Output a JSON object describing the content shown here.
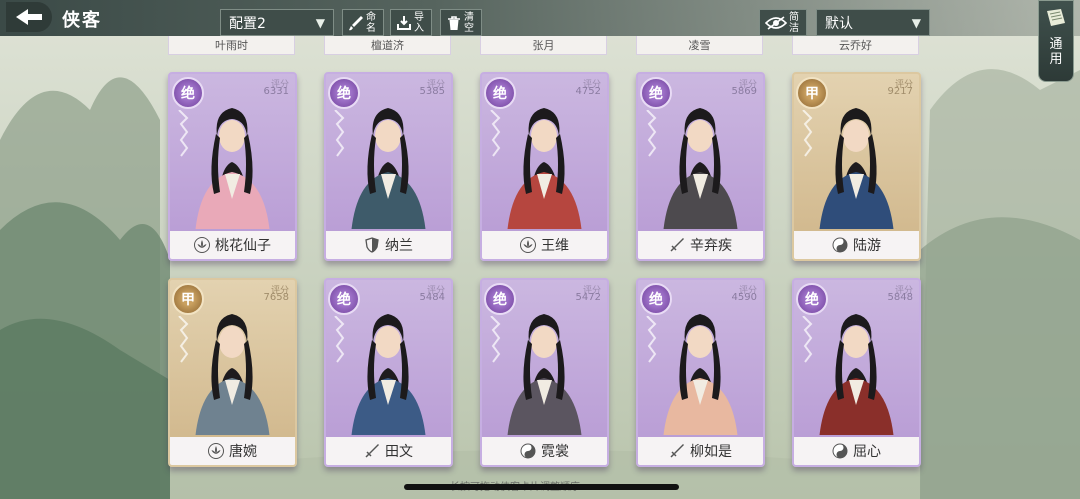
{
  "header": {
    "title": "侠客",
    "config_select": "配置2",
    "rename_label": "命名",
    "import_label": "导入",
    "clear_label": "清空",
    "concise_label": "简洁",
    "sort_select": "默认",
    "general_label": "通用"
  },
  "top_row_partial": [
    "叶雨时",
    "檀道济",
    "张月",
    "凌雪",
    "云乔好"
  ],
  "score_label": "评分",
  "cards": [
    {
      "grade": "绝",
      "rarity": "jue",
      "score": "6331",
      "name": "桃花仙子",
      "school_icon": "lotus-icon"
    },
    {
      "grade": "绝",
      "rarity": "jue",
      "score": "5385",
      "name": "纳兰",
      "school_icon": "shield-icon"
    },
    {
      "grade": "绝",
      "rarity": "jue",
      "score": "4752",
      "name": "王维",
      "school_icon": "lotus-icon"
    },
    {
      "grade": "绝",
      "rarity": "jue",
      "score": "5869",
      "name": "辛弃疾",
      "school_icon": "sword-icon"
    },
    {
      "grade": "甲",
      "rarity": "jia",
      "score": "9217",
      "name": "陆游",
      "school_icon": "taiji-icon"
    },
    {
      "grade": "甲",
      "rarity": "jia",
      "score": "7658",
      "name": "唐婉",
      "school_icon": "lotus-icon"
    },
    {
      "grade": "绝",
      "rarity": "jue",
      "score": "5484",
      "name": "田文",
      "school_icon": "sword-icon"
    },
    {
      "grade": "绝",
      "rarity": "jue",
      "score": "5472",
      "name": "霓裳",
      "school_icon": "taiji-icon"
    },
    {
      "grade": "绝",
      "rarity": "jue",
      "score": "4590",
      "name": "柳如是",
      "school_icon": "sword-icon"
    },
    {
      "grade": "绝",
      "rarity": "jue",
      "score": "5848",
      "name": "屈心",
      "school_icon": "taiji-icon"
    }
  ],
  "bottom_hint": "长按可拖动侠客卡片调整顺序",
  "colors": {
    "jue": "#b79ad4",
    "jia": "#cfb589",
    "topbar": "#3f4d49"
  }
}
